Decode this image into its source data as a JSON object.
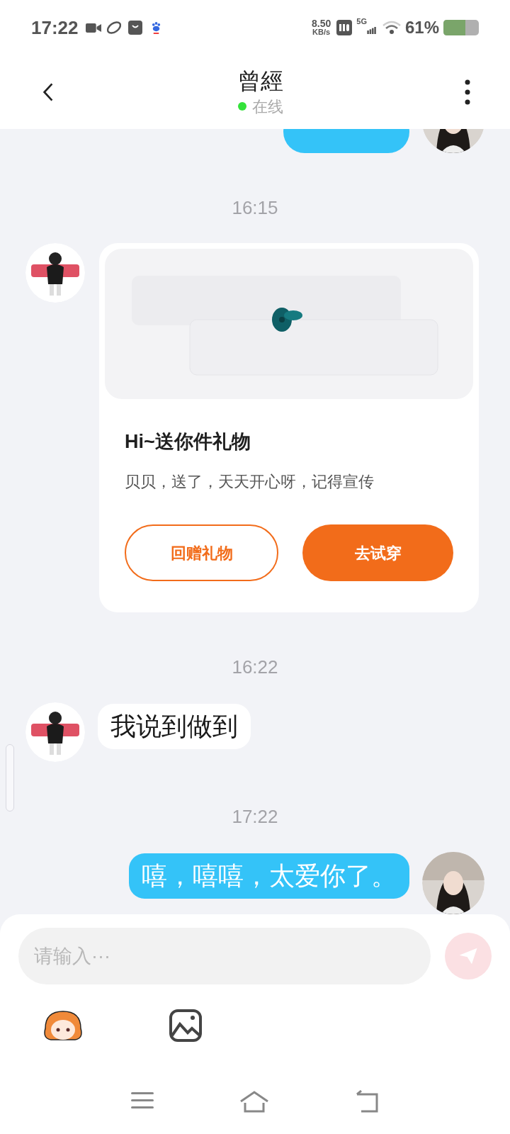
{
  "status_bar": {
    "time": "17:22",
    "speed_value": "8.50",
    "speed_unit": "KB/s",
    "network": "5G",
    "battery": "61%"
  },
  "header": {
    "title": "曾經",
    "presence": "在线",
    "online": true
  },
  "messages": [
    {
      "kind": "partial",
      "outgoing": true
    },
    {
      "kind": "time",
      "text": "16:15"
    },
    {
      "kind": "gift",
      "outgoing": false,
      "title": "Hi~送你件礼物",
      "note": "贝贝，送了，天天开心呀，记得宣传",
      "buttons": [
        {
          "label": "回赠礼物",
          "primary": false
        },
        {
          "label": "去试穿",
          "primary": true
        }
      ]
    },
    {
      "kind": "time",
      "text": "16:22"
    },
    {
      "kind": "text",
      "outgoing": false,
      "text": "我说到做到"
    },
    {
      "kind": "time",
      "text": "17:22"
    },
    {
      "kind": "text",
      "outgoing": true,
      "text": "嘻，嘻嘻，太爱你了。"
    }
  ],
  "composer": {
    "placeholder": "请输入···"
  }
}
